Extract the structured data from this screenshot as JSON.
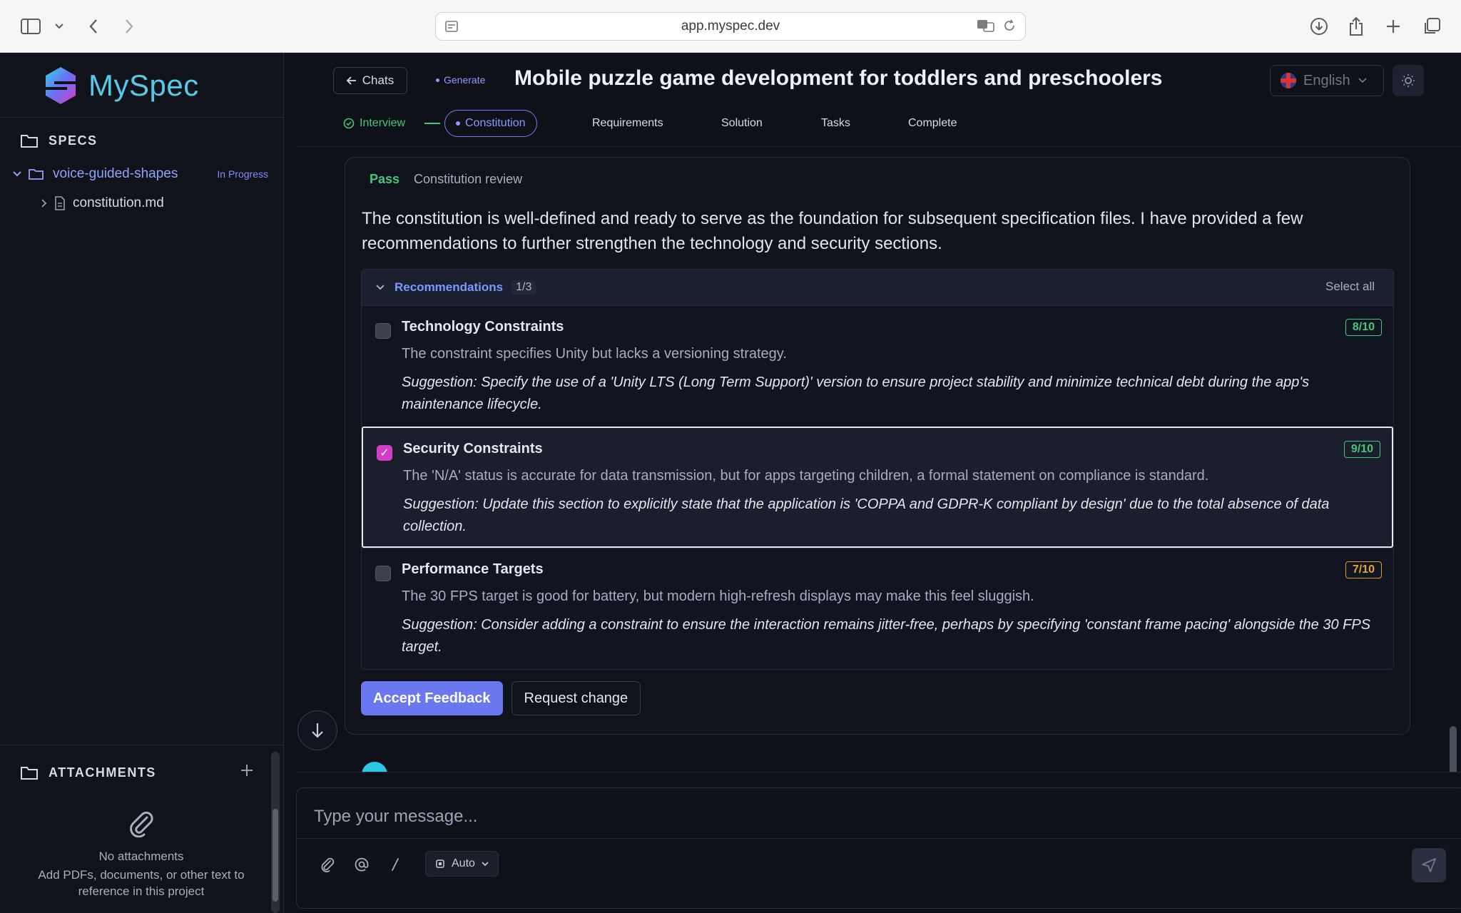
{
  "browser": {
    "url": "app.myspec.dev"
  },
  "sidebar": {
    "logo": "MySpec",
    "specs_heading": "SPECS",
    "project": {
      "name": "voice-guided-shapes",
      "status": "In Progress"
    },
    "file": "constitution.md",
    "attachments_heading": "ATTACHMENTS",
    "attachments_empty_title": "No attachments",
    "attachments_empty_hint": "Add PDFs, documents, or other text to reference in this project"
  },
  "header": {
    "back_label": "Chats",
    "mode": "Generate",
    "title": "Mobile puzzle game development for toddlers and preschoolers",
    "language": "English",
    "steps": [
      "Interview",
      "Constitution",
      "Requirements",
      "Solution",
      "Tasks",
      "Complete"
    ],
    "active_step": "Constitution"
  },
  "review": {
    "status": "Pass",
    "label": "Constitution review",
    "summary": "The constitution is well-defined and ready to serve as the foundation for subsequent specification files. I have provided a few recommendations to further strengthen the technology and security sections.",
    "recommendations_label": "Recommendations",
    "recommendations_count": "1/3",
    "select_all": "Select all",
    "items": [
      {
        "title": "Technology Constraints",
        "score": "8/10",
        "checked": false,
        "description": "The constraint specifies Unity but lacks a versioning strategy.",
        "suggestion": "Suggestion: Specify the use of a 'Unity LTS (Long Term Support)' version to ensure project stability and minimize technical debt during the app's maintenance lifecycle."
      },
      {
        "title": "Security Constraints",
        "score": "9/10",
        "checked": true,
        "description": "The 'N/A' status is accurate for data transmission, but for apps targeting children, a formal statement on compliance is standard.",
        "suggestion": "Suggestion: Update this section to explicitly state that the application is 'COPPA and GDPR-K compliant by design' due to the total absence of data collection."
      },
      {
        "title": "Performance Targets",
        "score": "7/10",
        "checked": false,
        "description": "The 30 FPS target is good for battery, but modern high-refresh displays may make this feel sluggish.",
        "suggestion": "Suggestion: Consider adding a constraint to ensure the interaction remains jitter-free, perhaps by specifying 'constant frame pacing' alongside the 30 FPS target."
      }
    ],
    "accept_label": "Accept Feedback",
    "request_label": "Request change"
  },
  "composer": {
    "placeholder": "Type your message...",
    "model": "Auto"
  },
  "colors": {
    "accent": "#6a78f0",
    "success": "#43c77a",
    "warning": "#e3a52b",
    "checkbox_on": "#d23fc7"
  }
}
